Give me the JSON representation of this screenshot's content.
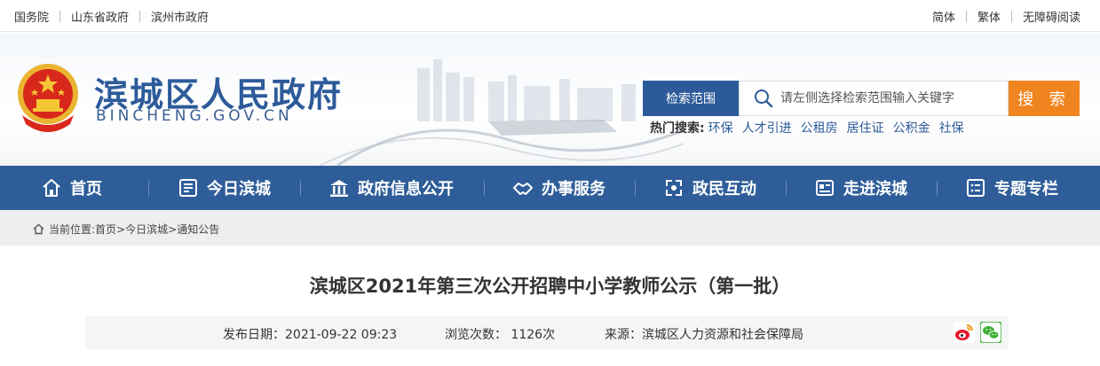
{
  "topbar": {
    "left_links": [
      "国务院",
      "山东省政府",
      "滨州市政府"
    ],
    "right_links": [
      "简体",
      "繁体",
      "无障碍阅读"
    ]
  },
  "header": {
    "site_name": "滨城区人民政府",
    "site_domain": "BINCHENG.GOV.CN",
    "search": {
      "scope_label": "检索范围",
      "placeholder": "请左侧选择检索范围输入关键字",
      "button_label": "搜 索"
    },
    "hot_search": {
      "label": "热门搜索:",
      "terms": [
        "环保",
        "人才引进",
        "公租房",
        "居住证",
        "公积金",
        "社保"
      ]
    }
  },
  "nav": {
    "items": [
      {
        "label": "首页",
        "icon": "home-icon"
      },
      {
        "label": "今日滨城",
        "icon": "newspaper-icon"
      },
      {
        "label": "政府信息公开",
        "icon": "government-building-icon"
      },
      {
        "label": "办事服务",
        "icon": "handshake-icon"
      },
      {
        "label": "政民互动",
        "icon": "interaction-icon"
      },
      {
        "label": "走进滨城",
        "icon": "id-card-icon"
      },
      {
        "label": "专题专栏",
        "icon": "list-icon"
      }
    ]
  },
  "breadcrumb": {
    "prefix": "当前位置:",
    "items": [
      "首页",
      "今日滨城",
      "通知公告"
    ],
    "separator": ">"
  },
  "article": {
    "title": "滨城区2021年第三次公开招聘中小学教师公示（第一批）",
    "publish_label": "发布日期：2021-09-22 09:23",
    "views_label": "浏览次数： 1126次",
    "source_label": "来源：滨城区人力资源和社会保障局"
  },
  "share": {
    "icons": [
      "weibo-icon",
      "wechat-icon"
    ]
  },
  "colors": {
    "brand_blue": "#2e5d99",
    "search_orange": "#f0841e",
    "link_blue": "#2d5b9a"
  }
}
